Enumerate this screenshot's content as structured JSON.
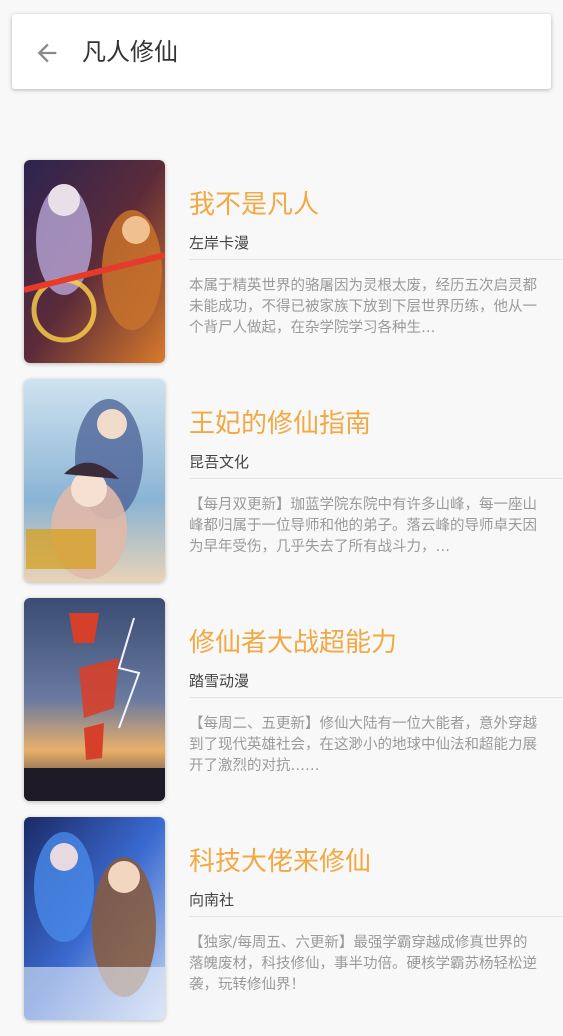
{
  "search": {
    "back_icon": "arrow-left-icon",
    "query": "凡人修仙"
  },
  "results": [
    {
      "title": "我不是凡人",
      "author": "左岸卡漫",
      "description": "本属于精英世界的骆屠因为灵根太废，经历五次启灵都未能成功，不得已被家族下放到下层世界历练，他从一个背尸人做起，在杂学院学习各种生…"
    },
    {
      "title": "王妃的修仙指南",
      "author": "昆吾文化",
      "description": "【每月双更新】珈蓝学院东院中有许多山峰，每一座山峰都归属于一位导师和他的弟子。落云峰的导师卓天因为早年受伤，几乎失去了所有战斗力，…"
    },
    {
      "title": "修仙者大战超能力",
      "author": "踏雪动漫",
      "description": "【每周二、五更新】修仙大陆有一位大能者，意外穿越到了现代英雄社会，在这渺小的地球中仙法和超能力展开了激烈的对抗……"
    },
    {
      "title": "科技大佬来修仙",
      "author": "向南社",
      "description": "【独家/每周五、六更新】最强学霸穿越成修真世界的落魄废材，科技修仙，事半功倍。硬核学霸苏杨轻松逆袭，玩转修仙界！"
    }
  ]
}
